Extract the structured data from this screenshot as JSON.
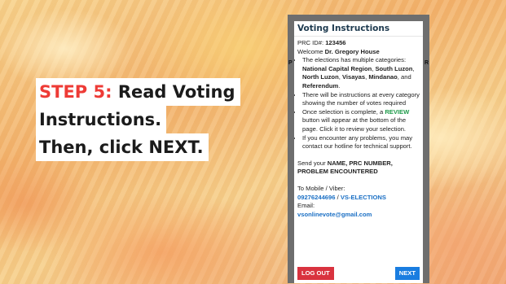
{
  "step": {
    "label": "STEP 5:",
    "line1_rest": " Read Voting",
    "line2": "Instructions.",
    "line3": "Then, click NEXT."
  },
  "panel": {
    "title": "Voting Instructions",
    "prc_label": "PRC ID#: ",
    "prc_id": "123456",
    "welcome_label": "Welcome ",
    "user_name": "Dr. Gregory House",
    "bullet1_text": "The elections has multiple categories: ",
    "categories": {
      "c1": "National Capital Region",
      "c2": "South Luzon",
      "c3": "North Luzon",
      "c4": "Visayas",
      "c5": "Mindanao",
      "c6": "Referendum"
    },
    "sep_comma": ", ",
    "sep_and": ", and ",
    "period": ".",
    "bullet2": "There will be instructions at every category showing the number of votes required",
    "bullet3_pre": "Once selection is complete, a ",
    "bullet3_highlight": "REVIEW",
    "bullet3_post": " button will appear at the bottom of the page. Click it to review your selection.",
    "bullet4": "If you encounter any problems, you may contact our hotline for technical support.",
    "send_pre": "Send your ",
    "send_bold": "NAME, PRC NUMBER, PROBLEM ENCOUNTERED",
    "mobile_label": "To Mobile / Viber:",
    "mobile_number": "09276244696",
    "mobile_sep": " / ",
    "mobile_name": "VS-ELECTIONS",
    "email_label": "Email:",
    "email_value": "vsonlinevote@gmail.com",
    "logout_label": "LOG OUT",
    "next_label": "NEXT",
    "edge_left": "P",
    "edge_right": "R"
  },
  "colors": {
    "step_label": "#ee3b36",
    "review": "#1e9b4a",
    "link": "#1a6fc4",
    "logout_bg": "#d9333f",
    "next_bg": "#1a7de0",
    "title": "#1e3a4f"
  }
}
